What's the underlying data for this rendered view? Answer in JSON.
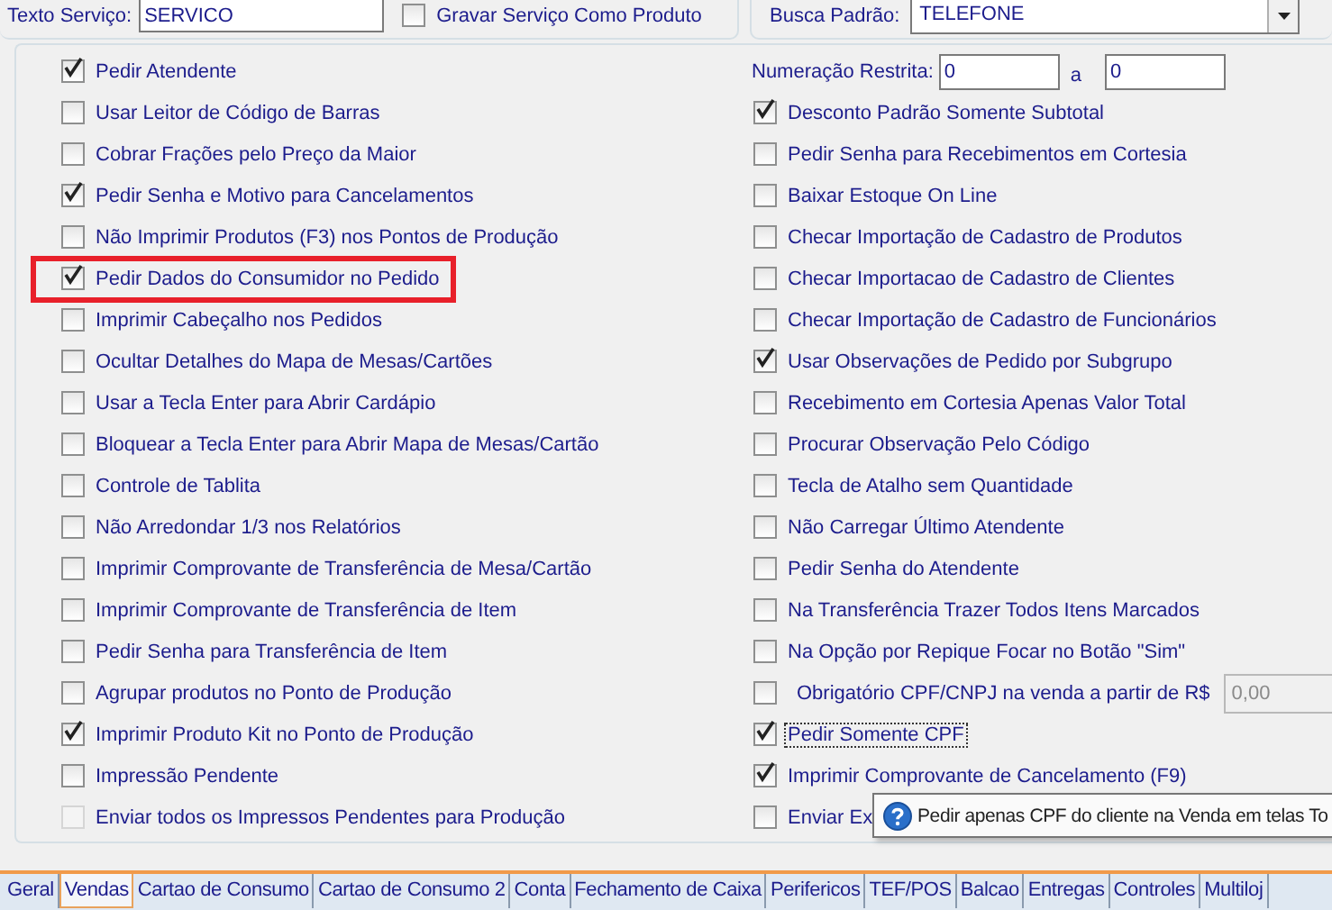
{
  "service_text": {
    "label": "Texto Serviço:",
    "value": "SERVICO"
  },
  "save_service_as_product": {
    "label": "Gravar Serviço Como Produto",
    "checked": false
  },
  "default_search": {
    "label": "Busca Padrão:",
    "value": "TELEFONE"
  },
  "restricted_numbering": {
    "label": "Numeração Restrita:",
    "from": "0",
    "separator": "a",
    "to": "0"
  },
  "left_options": [
    {
      "label": "Pedir Atendente",
      "checked": true,
      "disabled": false,
      "highlighted": false
    },
    {
      "label": "Usar Leitor de Código de Barras",
      "checked": false,
      "disabled": false,
      "highlighted": false
    },
    {
      "label": "Cobrar Frações pelo Preço da Maior",
      "checked": false,
      "disabled": false,
      "highlighted": false
    },
    {
      "label": "Pedir Senha e Motivo para Cancelamentos",
      "checked": true,
      "disabled": false,
      "highlighted": false
    },
    {
      "label": "Não Imprimir Produtos (F3) nos Pontos de Produção",
      "checked": false,
      "disabled": false,
      "highlighted": false
    },
    {
      "label": "Pedir Dados do Consumidor no Pedido",
      "checked": true,
      "disabled": false,
      "highlighted": true
    },
    {
      "label": "Imprimir Cabeçalho nos Pedidos",
      "checked": false,
      "disabled": false,
      "highlighted": false
    },
    {
      "label": "Ocultar Detalhes do Mapa de Mesas/Cartões",
      "checked": false,
      "disabled": false,
      "highlighted": false
    },
    {
      "label": "Usar a Tecla Enter para Abrir Cardápio",
      "checked": false,
      "disabled": false,
      "highlighted": false
    },
    {
      "label": "Bloquear a Tecla Enter para Abrir Mapa de Mesas/Cartão",
      "checked": false,
      "disabled": false,
      "highlighted": false
    },
    {
      "label": "Controle de Tablita",
      "checked": false,
      "disabled": false,
      "highlighted": false
    },
    {
      "label": "Não Arredondar 1/3 nos Relatórios",
      "checked": false,
      "disabled": false,
      "highlighted": false
    },
    {
      "label": "Imprimir Comprovante de Transferência de Mesa/Cartão",
      "checked": false,
      "disabled": false,
      "highlighted": false
    },
    {
      "label": "Imprimir Comprovante de Transferência de Item",
      "checked": false,
      "disabled": false,
      "highlighted": false
    },
    {
      "label": "Pedir Senha para Transferência de Item",
      "checked": false,
      "disabled": false,
      "highlighted": false
    },
    {
      "label": "Agrupar produtos no Ponto de Produção",
      "checked": false,
      "disabled": false,
      "highlighted": false
    },
    {
      "label": "Imprimir Produto Kit no Ponto de Produção",
      "checked": true,
      "disabled": false,
      "highlighted": false
    },
    {
      "label": "Impressão Pendente",
      "checked": false,
      "disabled": false,
      "highlighted": false
    },
    {
      "label": "Enviar todos os Impressos Pendentes para Produção",
      "checked": false,
      "disabled": true,
      "highlighted": false
    }
  ],
  "right_options": [
    {
      "kind": "check",
      "label": "Desconto Padrão Somente Subtotal",
      "checked": true,
      "focused": false
    },
    {
      "kind": "check",
      "label": "Pedir Senha para Recebimentos em Cortesia",
      "checked": false,
      "focused": false
    },
    {
      "kind": "check",
      "label": "Baixar Estoque On Line",
      "checked": false,
      "focused": false
    },
    {
      "kind": "check",
      "label": "Checar Importação de Cadastro de Produtos",
      "checked": false,
      "focused": false
    },
    {
      "kind": "check",
      "label": "Checar Importacao de Cadastro de Clientes",
      "checked": false,
      "focused": false
    },
    {
      "kind": "check",
      "label": "Checar Importação de Cadastro de Funcionários",
      "checked": false,
      "focused": false
    },
    {
      "kind": "check",
      "label": "Usar Observações de Pedido por Subgrupo",
      "checked": true,
      "focused": false
    },
    {
      "kind": "check",
      "label": "Recebimento em Cortesia Apenas Valor Total",
      "checked": false,
      "focused": false
    },
    {
      "kind": "check",
      "label": "Procurar Observação Pelo Código",
      "checked": false,
      "focused": false
    },
    {
      "kind": "check",
      "label": "Tecla de Atalho sem Quantidade",
      "checked": false,
      "focused": false
    },
    {
      "kind": "check",
      "label": "Não Carregar Último Atendente",
      "checked": false,
      "focused": false
    },
    {
      "kind": "check",
      "label": "Pedir Senha do Atendente",
      "checked": false,
      "focused": false
    },
    {
      "kind": "check",
      "label": "Na Transferência Trazer Todos Itens Marcados",
      "checked": false,
      "focused": false
    },
    {
      "kind": "check",
      "label": "Na Opção por Repique Focar no Botão \"Sim\"",
      "checked": false,
      "focused": false
    },
    {
      "kind": "amount",
      "label": "Obrigatório CPF/CNPJ na venda a partir de R$",
      "checked": false,
      "focused": false,
      "value": "0,00"
    },
    {
      "kind": "check",
      "label": "Pedir Somente CPF",
      "checked": true,
      "focused": true
    },
    {
      "kind": "check",
      "label": "Imprimir Comprovante de Cancelamento (F9)",
      "checked": true,
      "focused": false
    },
    {
      "kind": "check",
      "label": "Enviar Ex",
      "checked": false,
      "focused": false
    }
  ],
  "tooltip": {
    "text": "Pedir apenas CPF do cliente na Venda em telas To"
  },
  "tabs": [
    {
      "label": "Geral",
      "selected": false
    },
    {
      "label": "Vendas",
      "selected": true
    },
    {
      "label": "Cartao de Consumo",
      "selected": false
    },
    {
      "label": "Cartao de Consumo 2",
      "selected": false
    },
    {
      "label": "Conta",
      "selected": false
    },
    {
      "label": "Fechamento de Caixa",
      "selected": false
    },
    {
      "label": "Perifericos",
      "selected": false
    },
    {
      "label": "TEF/POS",
      "selected": false
    },
    {
      "label": "Balcao",
      "selected": false
    },
    {
      "label": "Entregas",
      "selected": false
    },
    {
      "label": "Controles",
      "selected": false
    },
    {
      "label": "Multiloj",
      "selected": false
    }
  ]
}
